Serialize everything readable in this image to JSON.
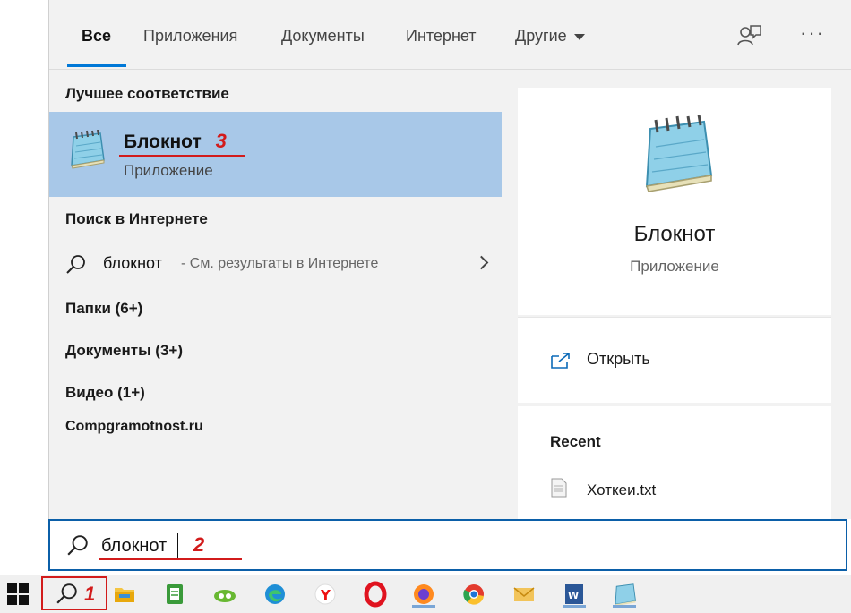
{
  "tabs": [
    {
      "label": "Все",
      "active": true
    },
    {
      "label": "Приложения"
    },
    {
      "label": "Документы"
    },
    {
      "label": "Интернет"
    },
    {
      "label": "Другие",
      "has_dropdown": true
    }
  ],
  "toolbar": {
    "feedback_icon": "feedback-icon",
    "more_label": "···"
  },
  "left": {
    "best_match_title": "Лучшее соответствие",
    "best_match": {
      "name": "Блокнот",
      "type": "Приложение",
      "annotation": "3"
    },
    "web_title": "Поиск в Интернете",
    "web_result": {
      "term": "блокнот",
      "hint": "- См. результаты в Интернете"
    },
    "categories": [
      "Папки (6+)",
      "Документы (3+)",
      "Видео (1+)",
      "Compgramotnost.ru"
    ]
  },
  "right": {
    "app_name": "Блокнот",
    "app_type": "Приложение",
    "open_label": "Открыть",
    "recent_title": "Recent",
    "recent_file": "Хоткеи.txt"
  },
  "search": {
    "value": "блокнот",
    "annotation": "2"
  },
  "taskbar": {
    "search_annotation": "1",
    "apps": [
      "file-explorer",
      "green-notes",
      "cloud-app",
      "edge",
      "yandex",
      "opera",
      "firefox",
      "chrome",
      "mail",
      "word",
      "notepad"
    ]
  },
  "colors": {
    "accent": "#0078d7",
    "selection": "#a8c8e8",
    "annotation": "#d21b1b"
  }
}
